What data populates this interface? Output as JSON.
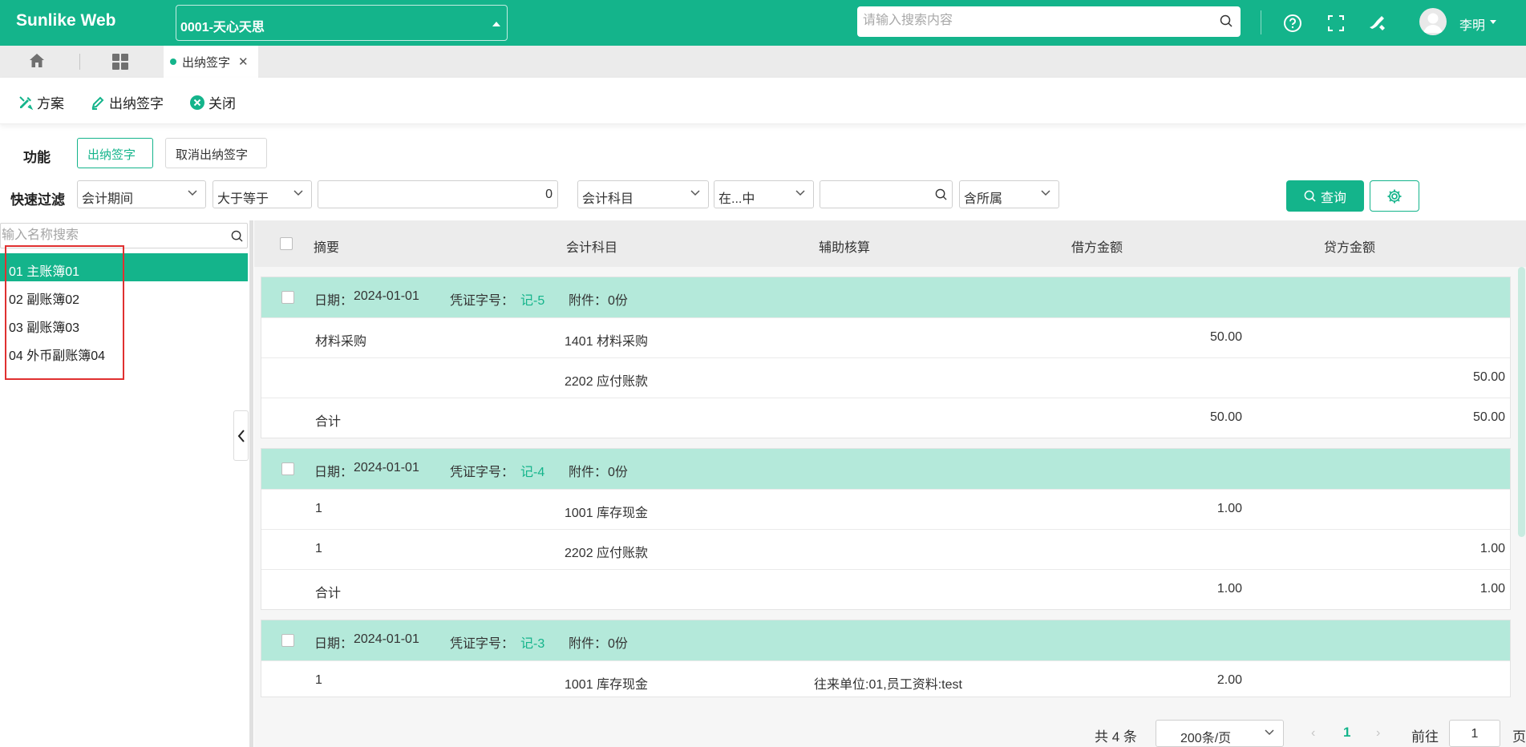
{
  "app": {
    "title": "Sunlike Web",
    "org_selector": "0001-天心天思"
  },
  "header": {
    "search_placeholder": "请输入搜索内容",
    "user_name": "李明"
  },
  "tabs": {
    "active_label": "出纳签字"
  },
  "toolbar": {
    "scheme": "方案",
    "cashier_sign": "出纳签字",
    "close": "关闭"
  },
  "functions": {
    "label": "功能",
    "sign": "出纳签字",
    "cancel_sign": "取消出纳签字"
  },
  "quick_filter": {
    "label": "快速过滤",
    "field1": "会计期间",
    "op1": "大于等于",
    "value1": "0",
    "field2": "会计科目",
    "op2": "在...中",
    "value2": "",
    "scope": "含所属",
    "query_button": "查询"
  },
  "left_panel": {
    "search_placeholder": "输入名称搜索",
    "items": [
      "01 主账簿01",
      "02 副账簿02",
      "03 副账簿03",
      "04 外币副账簿04"
    ]
  },
  "grid": {
    "columns": [
      "摘要",
      "会计科目",
      "辅助核算",
      "借方金额",
      "贷方金额"
    ],
    "labels": {
      "date": "日期：",
      "voucher_no": "凭证字号：",
      "attachment": "附件："
    },
    "vouchers": [
      {
        "date": "2024-01-01",
        "no": "记-5",
        "attachment": "0份",
        "rows": [
          {
            "summary": "材料采购",
            "account": "1401 材料采购",
            "aux": "",
            "debit": "50.00",
            "credit": ""
          },
          {
            "summary": "",
            "account": "2202 应付账款",
            "aux": "",
            "debit": "",
            "credit": "50.00"
          },
          {
            "summary": "合计",
            "account": "",
            "aux": "",
            "debit": "50.00",
            "credit": "50.00"
          }
        ]
      },
      {
        "date": "2024-01-01",
        "no": "记-4",
        "attachment": "0份",
        "rows": [
          {
            "summary": "1",
            "account": "1001 库存现金",
            "aux": "",
            "debit": "1.00",
            "credit": ""
          },
          {
            "summary": "1",
            "account": "2202 应付账款",
            "aux": "",
            "debit": "",
            "credit": "1.00"
          },
          {
            "summary": "合计",
            "account": "",
            "aux": "",
            "debit": "1.00",
            "credit": "1.00"
          }
        ]
      },
      {
        "date": "2024-01-01",
        "no": "记-3",
        "attachment": "0份",
        "rows": [
          {
            "summary": "1",
            "account": "1001 库存现金",
            "aux": "往来单位:01,员工资料:test",
            "debit": "2.00",
            "credit": ""
          }
        ]
      }
    ]
  },
  "pagination": {
    "total": "共 4 条",
    "page_size": "200条/页",
    "current": "1",
    "goto_label": "前往",
    "goto_value": "1",
    "page_suffix": "页"
  },
  "colors": {
    "brand": "#14b48b",
    "voucher_header": "#b4e9da",
    "highlight_box": "#e03030"
  }
}
